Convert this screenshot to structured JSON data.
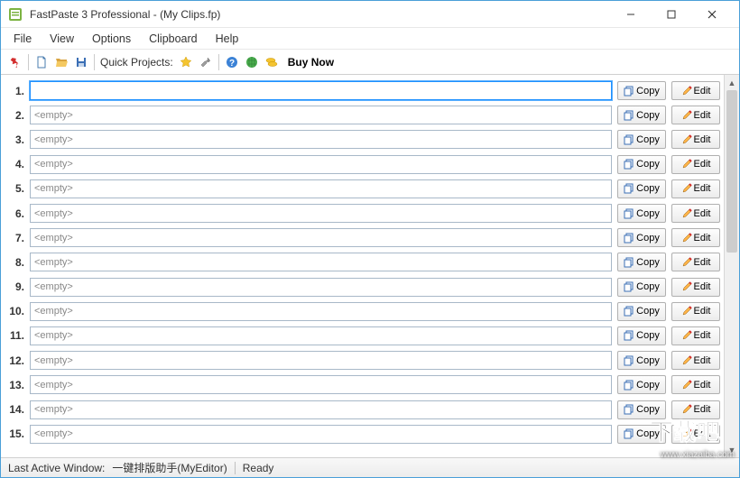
{
  "window": {
    "title": "FastPaste 3 Professional -  (My Clips.fp)"
  },
  "menu": {
    "file": "File",
    "view": "View",
    "options": "Options",
    "clipboard": "Clipboard",
    "help": "Help"
  },
  "toolbar": {
    "quick_projects_label": "Quick Projects:",
    "buy_now": "Buy Now"
  },
  "clips": [
    {
      "num": "1.",
      "value": "",
      "focused": true
    },
    {
      "num": "2.",
      "value": "<empty>",
      "focused": false
    },
    {
      "num": "3.",
      "value": "<empty>",
      "focused": false
    },
    {
      "num": "4.",
      "value": "<empty>",
      "focused": false
    },
    {
      "num": "5.",
      "value": "<empty>",
      "focused": false
    },
    {
      "num": "6.",
      "value": "<empty>",
      "focused": false
    },
    {
      "num": "7.",
      "value": "<empty>",
      "focused": false
    },
    {
      "num": "8.",
      "value": "<empty>",
      "focused": false
    },
    {
      "num": "9.",
      "value": "<empty>",
      "focused": false
    },
    {
      "num": "10.",
      "value": "<empty>",
      "focused": false
    },
    {
      "num": "11.",
      "value": "<empty>",
      "focused": false
    },
    {
      "num": "12.",
      "value": "<empty>",
      "focused": false
    },
    {
      "num": "13.",
      "value": "<empty>",
      "focused": false
    },
    {
      "num": "14.",
      "value": "<empty>",
      "focused": false
    },
    {
      "num": "15.",
      "value": "<empty>",
      "focused": false
    }
  ],
  "buttons": {
    "copy": "Copy",
    "edit": "Edit"
  },
  "status": {
    "last_active_label": "Last Active Window:",
    "last_active_value": "一键排版助手(MyEditor)",
    "ready": "Ready"
  },
  "watermark": {
    "url": "www.xiazaiba.com"
  }
}
